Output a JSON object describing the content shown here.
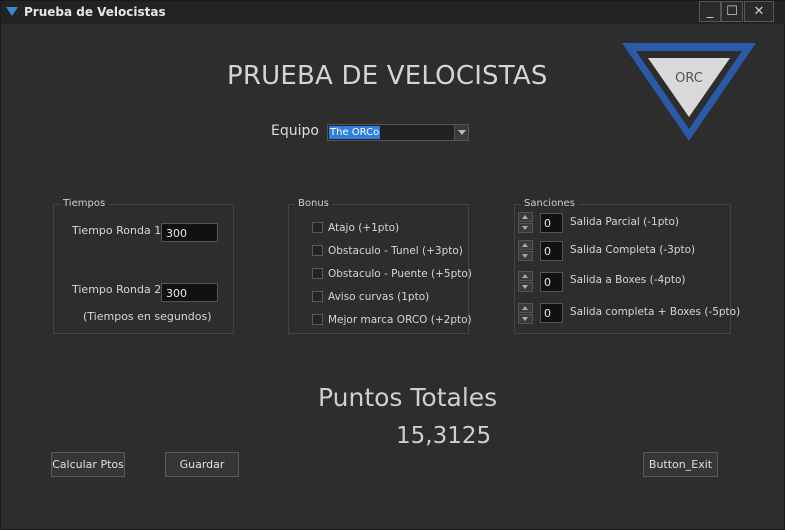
{
  "window": {
    "title": "Prueba de Velocistas",
    "controls": {
      "minimize": "_",
      "maximize": "☐",
      "close": "✕"
    }
  },
  "main_title": "PRUEBA DE VELOCISTAS",
  "logo": {
    "text": "ORC",
    "colors": {
      "frame": "#2a5aa8",
      "triangle": "#d9d9d9",
      "text": "#555555"
    }
  },
  "equipo": {
    "label": "Equipo",
    "selected": "The ORCo"
  },
  "tiempos": {
    "title": "Tiempos",
    "ronda1_label": "Tiempo Ronda 1:",
    "ronda1_value": "300",
    "ronda2_label": "Tiempo Ronda 2:",
    "ronda2_value": "300",
    "note": "(Tiempos en segundos)"
  },
  "bonus": {
    "title": "Bonus",
    "items": [
      {
        "label": "Atajo (+1pto)"
      },
      {
        "label": "Obstaculo - Tunel (+3pto)"
      },
      {
        "label": "Obstaculo - Puente (+5pto)"
      },
      {
        "label": "Aviso curvas (1pto)"
      },
      {
        "label": "Mejor marca ORCO (+2pto)"
      }
    ]
  },
  "sanciones": {
    "title": "Sanciones",
    "items": [
      {
        "label": "Salida Parcial (-1pto)",
        "value": "0"
      },
      {
        "label": "Salida Completa (-3pto)",
        "value": "0"
      },
      {
        "label": "Salida a Boxes (-4pto)",
        "value": "0"
      },
      {
        "label": "Salida completa + Boxes (-5pto)",
        "value": "0"
      }
    ]
  },
  "puntos": {
    "label": "Puntos Totales",
    "value": "15,3125"
  },
  "buttons": {
    "calcular": "Calcular Ptos",
    "guardar": "Guardar",
    "exit": "Button_Exit"
  },
  "colors": {
    "background": "#2d2d2d",
    "accent": "#2f7fe0"
  }
}
